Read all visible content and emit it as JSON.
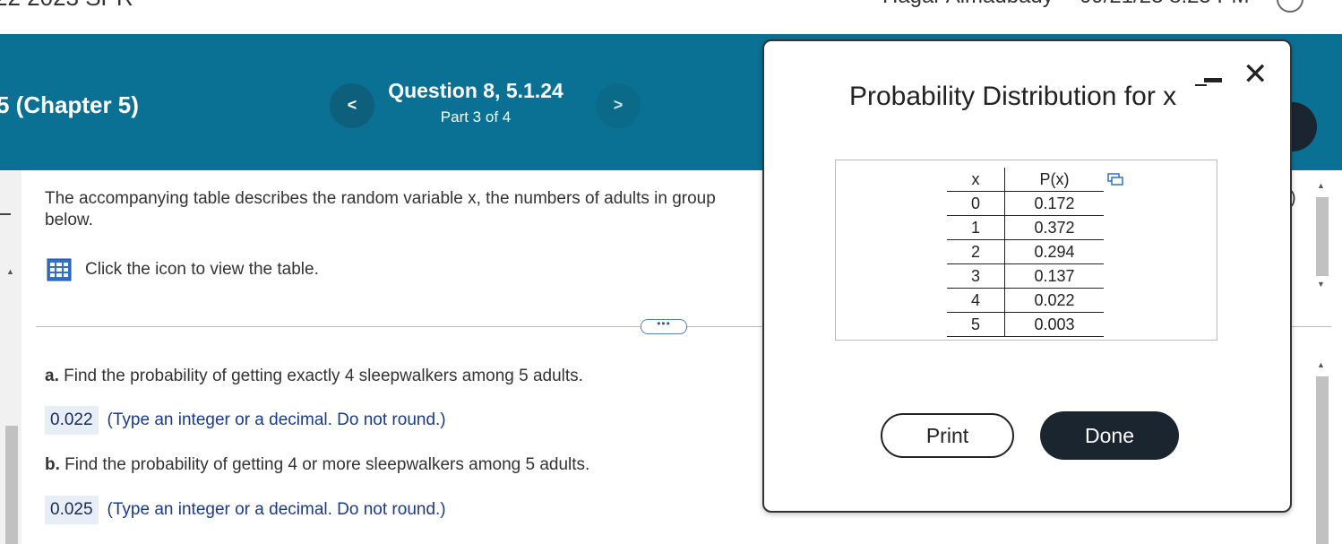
{
  "topbar": {
    "course_fragment": "22 2023 SPR",
    "user_fragment": "Hagar Almadbady",
    "date_fragment": "09/21/23 8:25 PM"
  },
  "header": {
    "chapter": "5 (Chapter 5)",
    "question_title": "Question 8, 5.1.24",
    "question_part": "Part 3 of 4",
    "prev_label": "<",
    "next_label": ">"
  },
  "content": {
    "prompt": "The accompanying table describes the random variable x, the numbers of adults in group",
    "prompt_cont": "below.",
    "table_link": "Click the icon to view the table.",
    "more_label": "•••",
    "part_a_letter": "a.",
    "part_a_text": " Find the probability of getting exactly 4 sleepwalkers among 5 adults.",
    "part_a_answer": "0.022",
    "part_a_hint": "(Type an integer or a decimal. Do not round.)",
    "part_b_letter": "b.",
    "part_b_text": " Find the probability of getting 4 or more sleepwalkers among 5 adults.",
    "part_b_answer": "0.025",
    "part_b_hint": "(Type an integer or a decimal. Do not round.)",
    "right_paren": ")"
  },
  "dialog": {
    "title": "Probability Distribution for x",
    "col_x": "x",
    "col_p": "P(x)",
    "rows": [
      {
        "x": "0",
        "p": "0.172"
      },
      {
        "x": "1",
        "p": "0.372"
      },
      {
        "x": "2",
        "p": "0.294"
      },
      {
        "x": "3",
        "p": "0.137"
      },
      {
        "x": "4",
        "p": "0.022"
      },
      {
        "x": "5",
        "p": "0.003"
      }
    ],
    "print_label": "Print",
    "done_label": "Done",
    "close_label": "✕"
  },
  "colors": {
    "header_bg": "#0a7194",
    "dark_button": "#1a2530",
    "answer_bg": "#e8eef5",
    "hint_text": "#1a3a8a"
  }
}
